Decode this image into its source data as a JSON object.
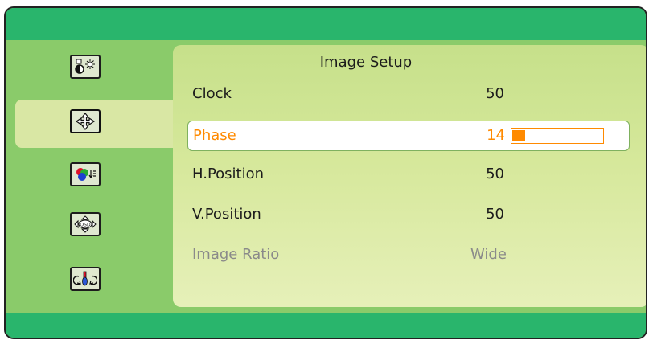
{
  "title": "Image Setup",
  "rows": [
    {
      "label": "Clock",
      "value": "50",
      "state": "normal"
    },
    {
      "label": "Phase",
      "value": "14",
      "state": "selected",
      "level": 0.14
    },
    {
      "label": "H.Position",
      "value": "50",
      "state": "normal"
    },
    {
      "label": "V.Position",
      "value": "50",
      "state": "normal"
    },
    {
      "label": "Image Ratio",
      "value": "Wide",
      "state": "disabled"
    }
  ],
  "sidebar": {
    "items": [
      {
        "icon": "brightness-contrast-icon"
      },
      {
        "icon": "image-setup-move-icon"
      },
      {
        "icon": "color-setup-icon"
      },
      {
        "icon": "osd-setup-icon"
      },
      {
        "icon": "extra-setup-icon"
      }
    ]
  },
  "colors": {
    "frame": "#8acb6a",
    "bars": "#29b56c",
    "panel": "#d6e89b",
    "selected_text": "#ff8a00"
  }
}
